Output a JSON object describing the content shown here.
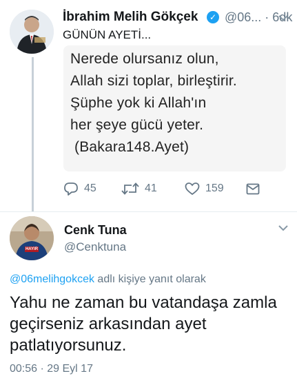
{
  "tweet1": {
    "author_name": "İbrahim Melih Gökçek",
    "handle_time": "@06... · 6dk",
    "text": "GÜNÜN AYETİ...",
    "quote_lines": [
      "Nerede olursanız olun,",
      "Allah sizi toplar, birleştirir.",
      "Şüphe yok ki Allah'ın",
      "her şeye gücü yeter.",
      "(Bakara148.Ayet)"
    ],
    "actions": {
      "reply_count": "45",
      "retweet_count": "41",
      "like_count": "159"
    }
  },
  "tweet2": {
    "author_name": "Cenk Tuna",
    "handle": "@Cenktuna",
    "avatar_badge": "HAYIR",
    "reply_to_handle": "@06melihgokcek",
    "reply_to_suffix": "adlı kişiye yanıt olarak",
    "text": "Yahu ne zaman bu vatandaşa zamla geçirseniz arkasından ayet patlatıyorsunuz.",
    "timestamp": "00:56 · 29 Eyl 17"
  },
  "colors": {
    "link": "#1da1f2",
    "muted": "#657786",
    "verified": "#1da1f2",
    "text": "#14171a"
  },
  "icons": [
    "verified-badge-icon",
    "chevron-down-icon",
    "reply-icon",
    "retweet-icon",
    "like-icon",
    "direct-message-icon"
  ]
}
